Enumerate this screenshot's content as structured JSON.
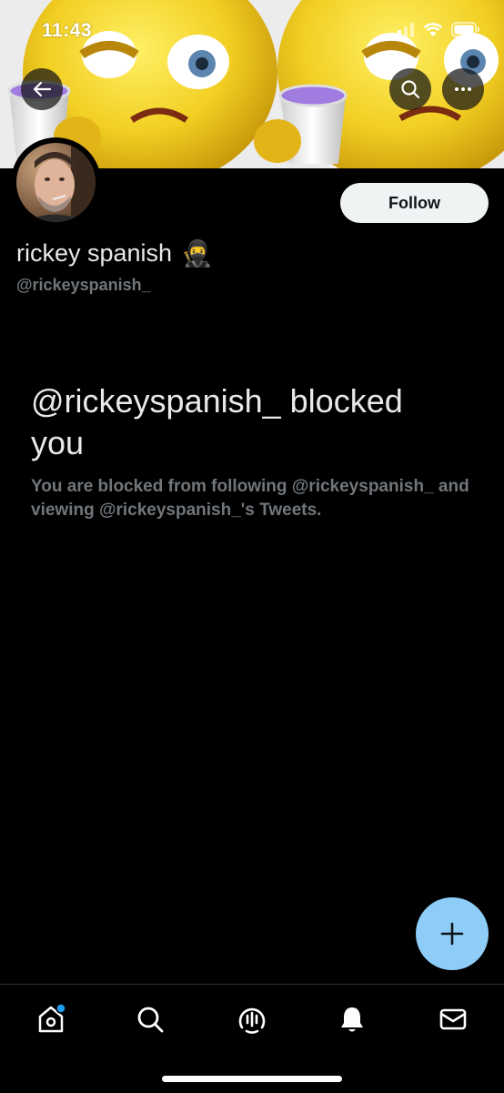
{
  "status_bar": {
    "time": "11:43"
  },
  "header": {
    "back_icon": "arrow-left-icon",
    "search_icon": "search-icon",
    "more_icon": "more-horizontal-icon"
  },
  "profile": {
    "display_name": "rickey spanish",
    "name_emoji": "🥷",
    "handle": "@rickeyspanish_",
    "follow_label": "Follow"
  },
  "blocked": {
    "title": "@rickeyspanish_ blocked you",
    "description": "You are blocked from following @rickeyspanish_ and viewing @rickeyspanish_'s Tweets."
  },
  "fab": {
    "icon": "plus-icon"
  },
  "tab_bar": {
    "items": [
      {
        "icon": "home-icon",
        "has_notification_dot": true
      },
      {
        "icon": "search-icon"
      },
      {
        "icon": "spaces-icon"
      },
      {
        "icon": "bell-icon"
      },
      {
        "icon": "mail-icon"
      }
    ]
  },
  "colors": {
    "background": "#000000",
    "fab": "#8ecdf8",
    "accent_dot": "#1d9bf0",
    "muted_text": "#71767b",
    "follow_button_bg": "#eff3f4"
  }
}
